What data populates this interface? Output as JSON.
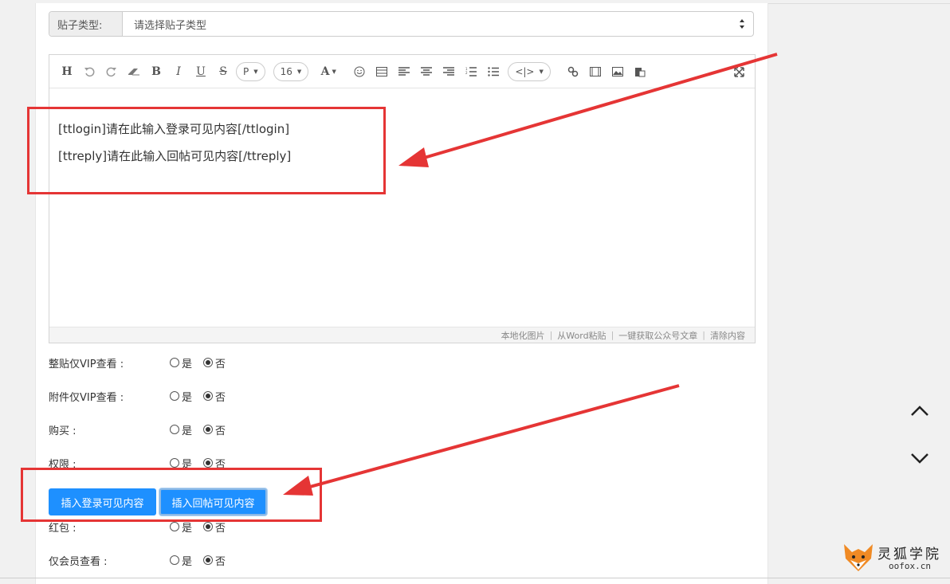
{
  "post_type": {
    "label": "贴子类型:",
    "placeholder": "请选择贴子类型"
  },
  "toolbar": {
    "heading": "H",
    "bold": "B",
    "italic": "I",
    "underline": "U",
    "strike": "S",
    "paragraph": "P",
    "font_size": "16",
    "font_color": "A",
    "code": "<|>"
  },
  "editor": {
    "line1": "[ttlogin]请在此输入登录可见内容[/ttlogin]",
    "line2": "[ttreply]请在此输入回帖可见内容[/ttreply]",
    "status": [
      "本地化图片",
      "从Word粘贴",
      "一键获取公众号文章",
      "清除内容"
    ]
  },
  "options": [
    {
      "label": "整贴仅VIP查看 :",
      "yes": "是",
      "no": "否"
    },
    {
      "label": "附件仅VIP查看 :",
      "yes": "是",
      "no": "否"
    },
    {
      "label": "购买 :",
      "yes": "是",
      "no": "否"
    },
    {
      "label": "权限 :",
      "yes": "是",
      "no": "否"
    },
    {
      "label": "红包 :",
      "yes": "是",
      "no": "否"
    },
    {
      "label": "仅会员查看 :",
      "yes": "是",
      "no": "否"
    }
  ],
  "buttons": {
    "insert_login": "插入登录可见内容",
    "insert_reply": "插入回帖可见内容"
  },
  "watermark": {
    "title": "灵狐学院",
    "site": "oofox.cn"
  },
  "colors": {
    "primary": "#1e90ff",
    "annotation": "#e53535"
  }
}
